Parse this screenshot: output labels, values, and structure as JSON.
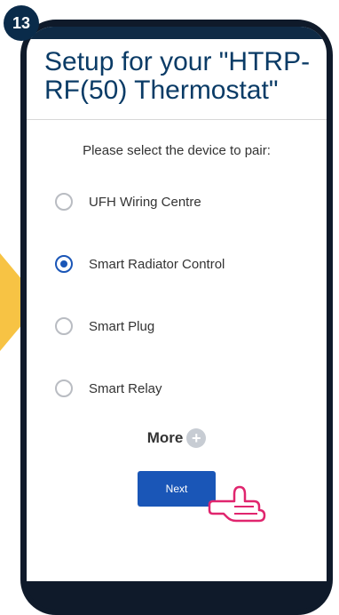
{
  "step": {
    "number": "13"
  },
  "colors": {
    "accent": "#1a56b7",
    "header": "#0f2a45",
    "arrow": "#f7c344"
  },
  "title": "Setup for your \"HTRP-RF(50) Thermostat\"",
  "prompt": "Please select the device to pair:",
  "options": [
    {
      "label": "UFH Wiring Centre",
      "selected": false
    },
    {
      "label": "Smart Radiator Control",
      "selected": true
    },
    {
      "label": "Smart Plug",
      "selected": false
    },
    {
      "label": "Smart Relay",
      "selected": false
    }
  ],
  "more": {
    "label": "More",
    "icon": "plus-icon"
  },
  "next_button": {
    "label": "Next"
  },
  "pointer": {
    "icon": "hand-pointer-icon"
  }
}
